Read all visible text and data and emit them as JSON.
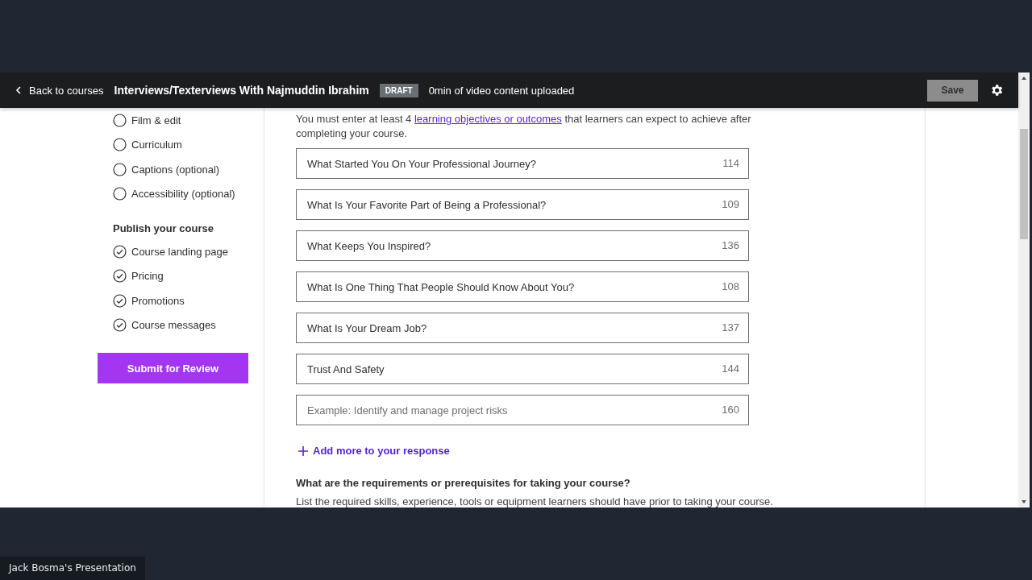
{
  "header": {
    "back_label": "Back to courses",
    "course_title": "Interviews/Texterviews With Najmuddin Ibrahim",
    "status_badge": "DRAFT",
    "video_info": "0min of video content uploaded",
    "save_button": "Save"
  },
  "sidebar": {
    "plan_items": [
      {
        "label": "Film & edit",
        "completed": false
      },
      {
        "label": "Curriculum",
        "completed": false
      },
      {
        "label": "Captions (optional)",
        "completed": false
      },
      {
        "label": "Accessibility (optional)",
        "completed": false
      }
    ],
    "publish_heading": "Publish your course",
    "publish_items": [
      {
        "label": "Course landing page",
        "completed": true
      },
      {
        "label": "Pricing",
        "completed": true
      },
      {
        "label": "Promotions",
        "completed": true
      },
      {
        "label": "Course messages",
        "completed": true
      }
    ],
    "submit_button": "Submit for Review"
  },
  "main": {
    "intro": {
      "before": "You must enter at least 4 ",
      "link": "learning objectives or outcomes",
      "after": " that learners can expect to achieve after completing your course."
    },
    "objectives": [
      {
        "value": "What Started You On Your Professional Journey?",
        "remaining": "114"
      },
      {
        "value": "What Is Your Favorite Part of Being a Professional?",
        "remaining": "109"
      },
      {
        "value": "What Keeps You Inspired?",
        "remaining": "136"
      },
      {
        "value": "What Is One Thing That People Should Know About You?",
        "remaining": "108"
      },
      {
        "value": "What Is Your Dream Job?",
        "remaining": "137"
      },
      {
        "value": "Trust And Safety",
        "remaining": "144"
      },
      {
        "placeholder": "Example: Identify and manage project risks",
        "remaining": "160"
      }
    ],
    "add_more": "Add more to your response",
    "next_question": "What are the requirements or prerequisites for taking your course?",
    "next_hint": "List the required skills, experience, tools or equipment learners should have prior to taking your course."
  },
  "presenter_label": "Jack Bosma's Presentation"
}
